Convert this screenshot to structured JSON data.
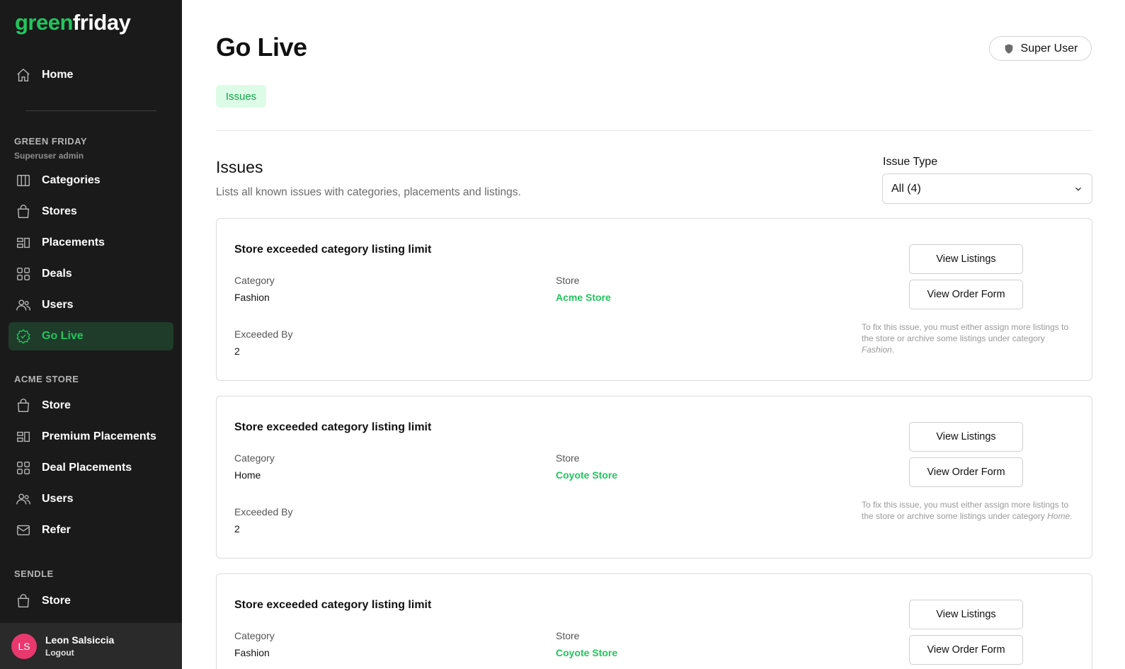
{
  "sidebar": {
    "logo_green": "green",
    "logo_white": "friday",
    "home_label": "Home",
    "section1": {
      "title": "GREEN FRIDAY",
      "subtitle": "Superuser admin"
    },
    "section1_items": [
      "Categories",
      "Stores",
      "Placements",
      "Deals",
      "Users",
      "Go Live"
    ],
    "section2": {
      "title": "ACME STORE"
    },
    "section2_items": [
      "Store",
      "Premium Placements",
      "Deal Placements",
      "Users",
      "Refer"
    ],
    "section3": {
      "title": "SENDLE"
    },
    "section3_items": [
      "Store"
    ],
    "user": {
      "initials": "LS",
      "name": "Leon Salsiccia",
      "logout": "Logout"
    }
  },
  "header": {
    "title": "Go Live",
    "super_user": "Super User",
    "tab": "Issues"
  },
  "issues": {
    "heading": "Issues",
    "description": "Lists all known issues with categories, placements and listings.",
    "filter_label": "Issue Type",
    "filter_value": "All (4)",
    "cards": [
      {
        "title": "Store exceeded category listing limit",
        "category_label": "Category",
        "category": "Fashion",
        "store_label": "Store",
        "store": "Acme Store",
        "exceeded_label": "Exceeded By",
        "exceeded": "2",
        "btn_listings": "View Listings",
        "btn_order": "View Order Form",
        "hint_prefix": "To fix this issue, you must either assign more listings to the store or archive some listings under category ",
        "hint_category": "Fashion",
        "hint_suffix": "."
      },
      {
        "title": "Store exceeded category listing limit",
        "category_label": "Category",
        "category": "Home",
        "store_label": "Store",
        "store": "Coyote Store",
        "exceeded_label": "Exceeded By",
        "exceeded": "2",
        "btn_listings": "View Listings",
        "btn_order": "View Order Form",
        "hint_prefix": "To fix this issue, you must either assign more listings to the store or archive some listings under category ",
        "hint_category": "Home",
        "hint_suffix": "."
      },
      {
        "title": "Store exceeded category listing limit",
        "category_label": "Category",
        "category": "Fashion",
        "store_label": "Store",
        "store": "Coyote Store",
        "btn_listings": "View Listings",
        "btn_order": "View Order Form"
      }
    ]
  },
  "colors": {
    "accent": "#22c55e",
    "sidebar_bg": "#1a1a1a",
    "avatar": "#e8386d"
  }
}
